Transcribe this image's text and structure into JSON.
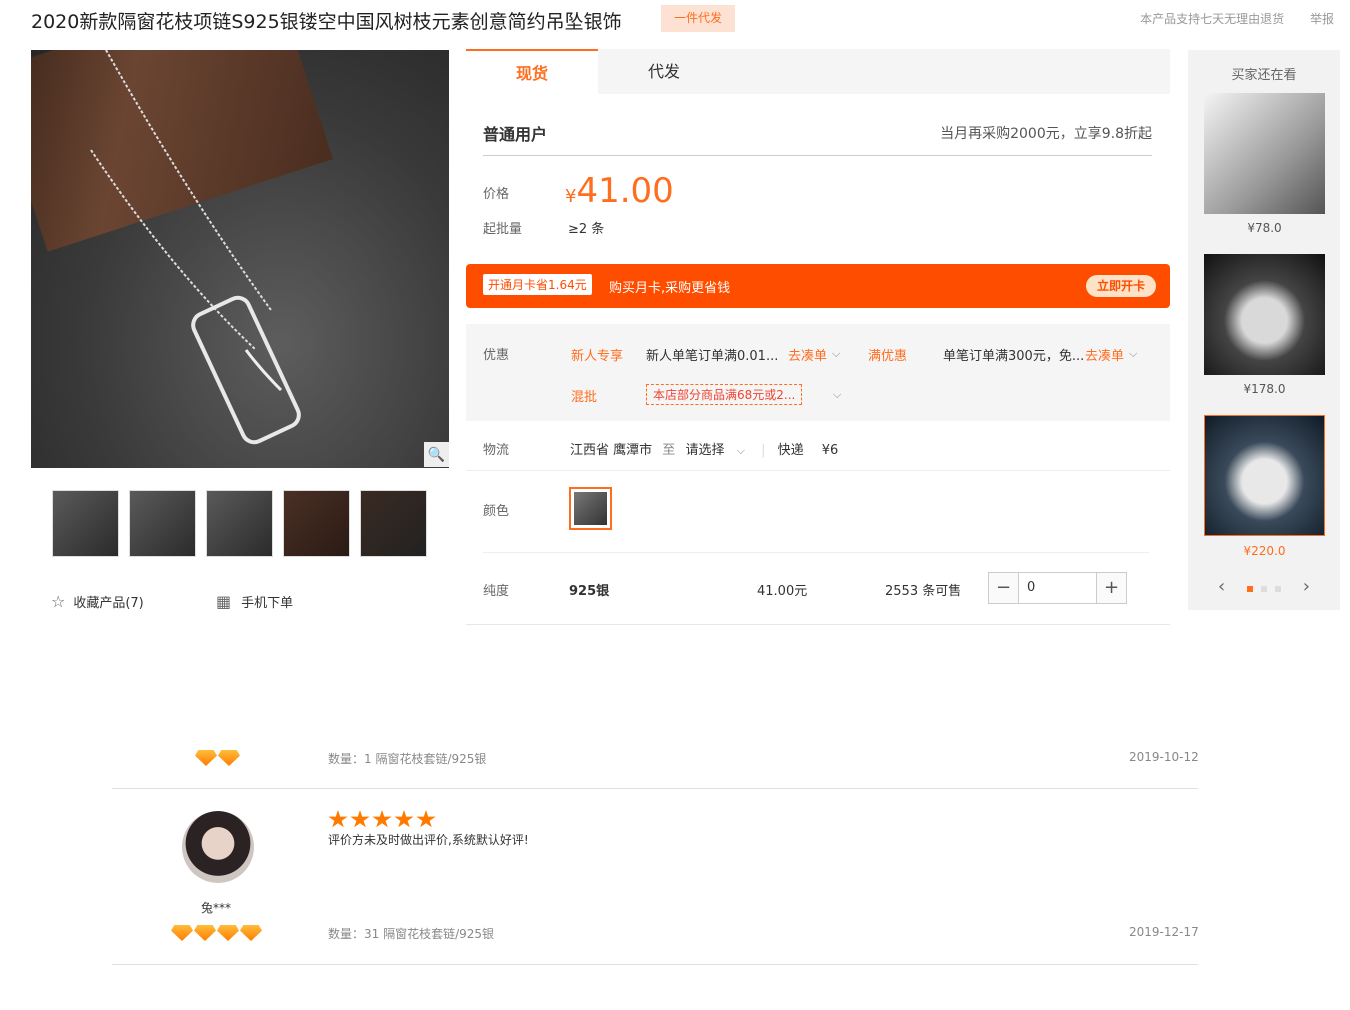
{
  "header": {
    "title": "2020新款隔窗花枝项链S925银镂空中国风树枝元素创意简约吊坠银饰",
    "badge": "一件代发",
    "links": [
      "本产品支持七天无理由退货",
      "举报"
    ]
  },
  "gallery": {
    "zoom_icon": "magnifier-icon",
    "thumbs": 5,
    "favorite_label": "收藏产品(7)",
    "mobile_label": "手机下单"
  },
  "tabs": [
    "现货",
    "代发"
  ],
  "pricing": {
    "user_type": "普通用户",
    "promo_note": "当月再采购2000元，立享9.8折起",
    "price_label": "价格",
    "currency": "¥",
    "price": "41.00",
    "moq_label": "起批量",
    "moq": "≥2 条"
  },
  "card_bar": {
    "tag": "开通月卡省1.64元",
    "text": "购买月卡,采购更省钱",
    "button": "立即开卡"
  },
  "promo": {
    "label": "优惠",
    "items": [
      {
        "tag": "新人专享",
        "desc": "新人单笔订单满0.01...",
        "action": "去凑单"
      },
      {
        "tag": "满优惠",
        "desc": "单笔订单满300元，免...",
        "action": "去凑单"
      }
    ],
    "mix_tag": "混批",
    "mix_desc": "本店部分商品满68元或2..."
  },
  "logistics": {
    "label": "物流",
    "from": "江西省 鹰潭市",
    "to_word": "至",
    "select": "请选择",
    "method": "快递",
    "fee": "¥6"
  },
  "color": {
    "label": "颜色"
  },
  "sku": {
    "label": "纯度",
    "value": "925银",
    "price": "41.00元",
    "stock": "2553 条可售",
    "qty": "0"
  },
  "rail": {
    "title": "买家还在看",
    "items": [
      {
        "price": "¥78.0"
      },
      {
        "price": "¥178.0"
      },
      {
        "price": "¥220.0"
      }
    ]
  },
  "reviews": [
    {
      "gems": 2,
      "meta": "数量：1   隔窗花枝套链/925银",
      "date": "2019-10-12"
    },
    {
      "user": "兔***",
      "gems": 4,
      "stars": 5,
      "text": "评价方未及时做出评价,系统默认好评!",
      "meta": "数量：31   隔窗花枝套链/925银",
      "date": "2019-12-17"
    }
  ]
}
